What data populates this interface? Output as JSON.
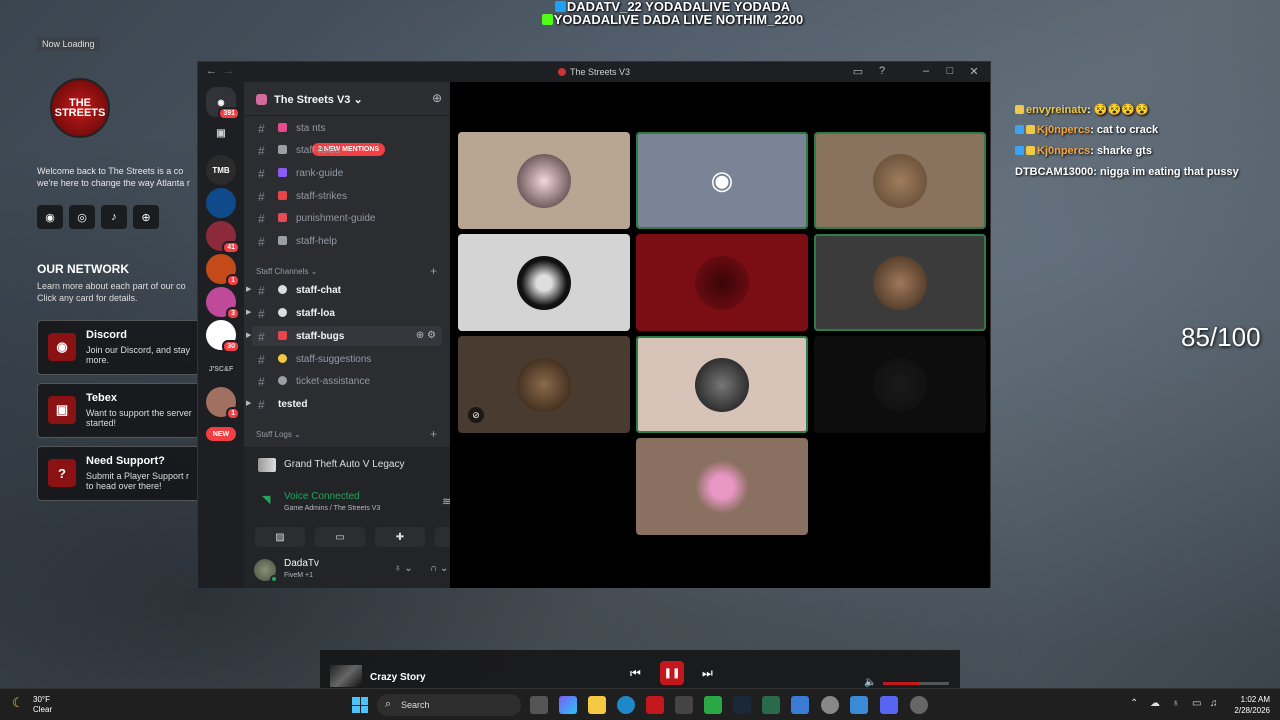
{
  "overlay": {
    "social_line1": "DADATV_22 YODADALIVE YODADA",
    "social_line2": "YODADALIVE DADA LIVE NOTHIM_2200",
    "score": "85/100"
  },
  "website": {
    "now_loading": "Now Loading",
    "logo_text": "THE STREETS",
    "welcome_line1": "Welcome back to The Streets is a co",
    "welcome_line2": "we're here to change the way Atlanta r",
    "network_title": "OUR NETWORK",
    "network_desc_line1": "Learn more about each part of our co",
    "network_desc_line2": "Click any card for details.",
    "cards": [
      {
        "title": "Discord",
        "desc1": "Join our Discord, and stay",
        "desc2": "more.",
        "icon": "discord-icon"
      },
      {
        "title": "Tebex",
        "desc1": "Want to support the server",
        "desc2": "started!",
        "icon": "bag-icon"
      },
      {
        "title": "Need Support?",
        "desc1": "Submit a Player Support r",
        "desc2": "to head over there!",
        "icon": "question-icon",
        "glyph": "?"
      }
    ]
  },
  "discord": {
    "window_title": "The Streets V3",
    "server_name": "The Streets V3",
    "mentions_pill": "2 NEW MENTIONS",
    "guild_badges": [
      "391",
      "41",
      "1",
      "3",
      "30",
      "1"
    ],
    "guild_labels": [
      "TMB",
      "J'SC&F",
      "NEW"
    ],
    "channels_top": [
      {
        "label": "sta                nts",
        "emoji_color": "#e84a8a"
      },
      {
        "label": "staff-rules",
        "emoji_color": "#9aa0a6"
      },
      {
        "label": "rank-guide",
        "emoji_color": "#8a5cf5"
      },
      {
        "label": "staff-strikes",
        "emoji_color": "#e8454a"
      },
      {
        "label": "punishment-guide",
        "emoji_color": "#e84a5a"
      },
      {
        "label": "staff-help",
        "emoji_color": "#9aa0a6"
      }
    ],
    "category_staff": "Staff Channels",
    "channels_staff": [
      {
        "label": "staff-chat",
        "unread": true
      },
      {
        "label": "staff-loa",
        "unread": true
      },
      {
        "label": "staff-bugs",
        "unread": true
      },
      {
        "label": "staff-suggestions",
        "unread": false
      },
      {
        "label": "ticket-assistance",
        "unread": false
      }
    ],
    "channel_tested": "tested",
    "category_logs": "Staff Logs",
    "activity": "Grand Theft Auto V Legacy",
    "voice_status": "Voice Connected",
    "voice_channel": "Game Admins / The Streets V3",
    "username": "DadaTv",
    "user_status": "FiveM +1",
    "colors": {
      "accent": "#5865f2",
      "voice_green": "#23a55a",
      "mention_red": "#f23f43"
    }
  },
  "chat": [
    {
      "user": "envyreinatv",
      "msg": ": 😵😵😵😵",
      "color": "#f0c94a"
    },
    {
      "user": "Kj0npercs",
      "msg": ": cat to crack",
      "color": "#f5a742"
    },
    {
      "user": "Kj0npercs",
      "msg": ": sharke gts",
      "color": "#f5a742"
    },
    {
      "user": "DTBCAM13000",
      "msg": ": nigga im eating that pussy",
      "color": "#ffffff"
    }
  ],
  "music": {
    "song": "Crazy Story"
  },
  "taskbar": {
    "temp": "30°F",
    "condition": "Clear",
    "search": "Search",
    "time": "1:02 AM",
    "date": "2/28/2026"
  }
}
